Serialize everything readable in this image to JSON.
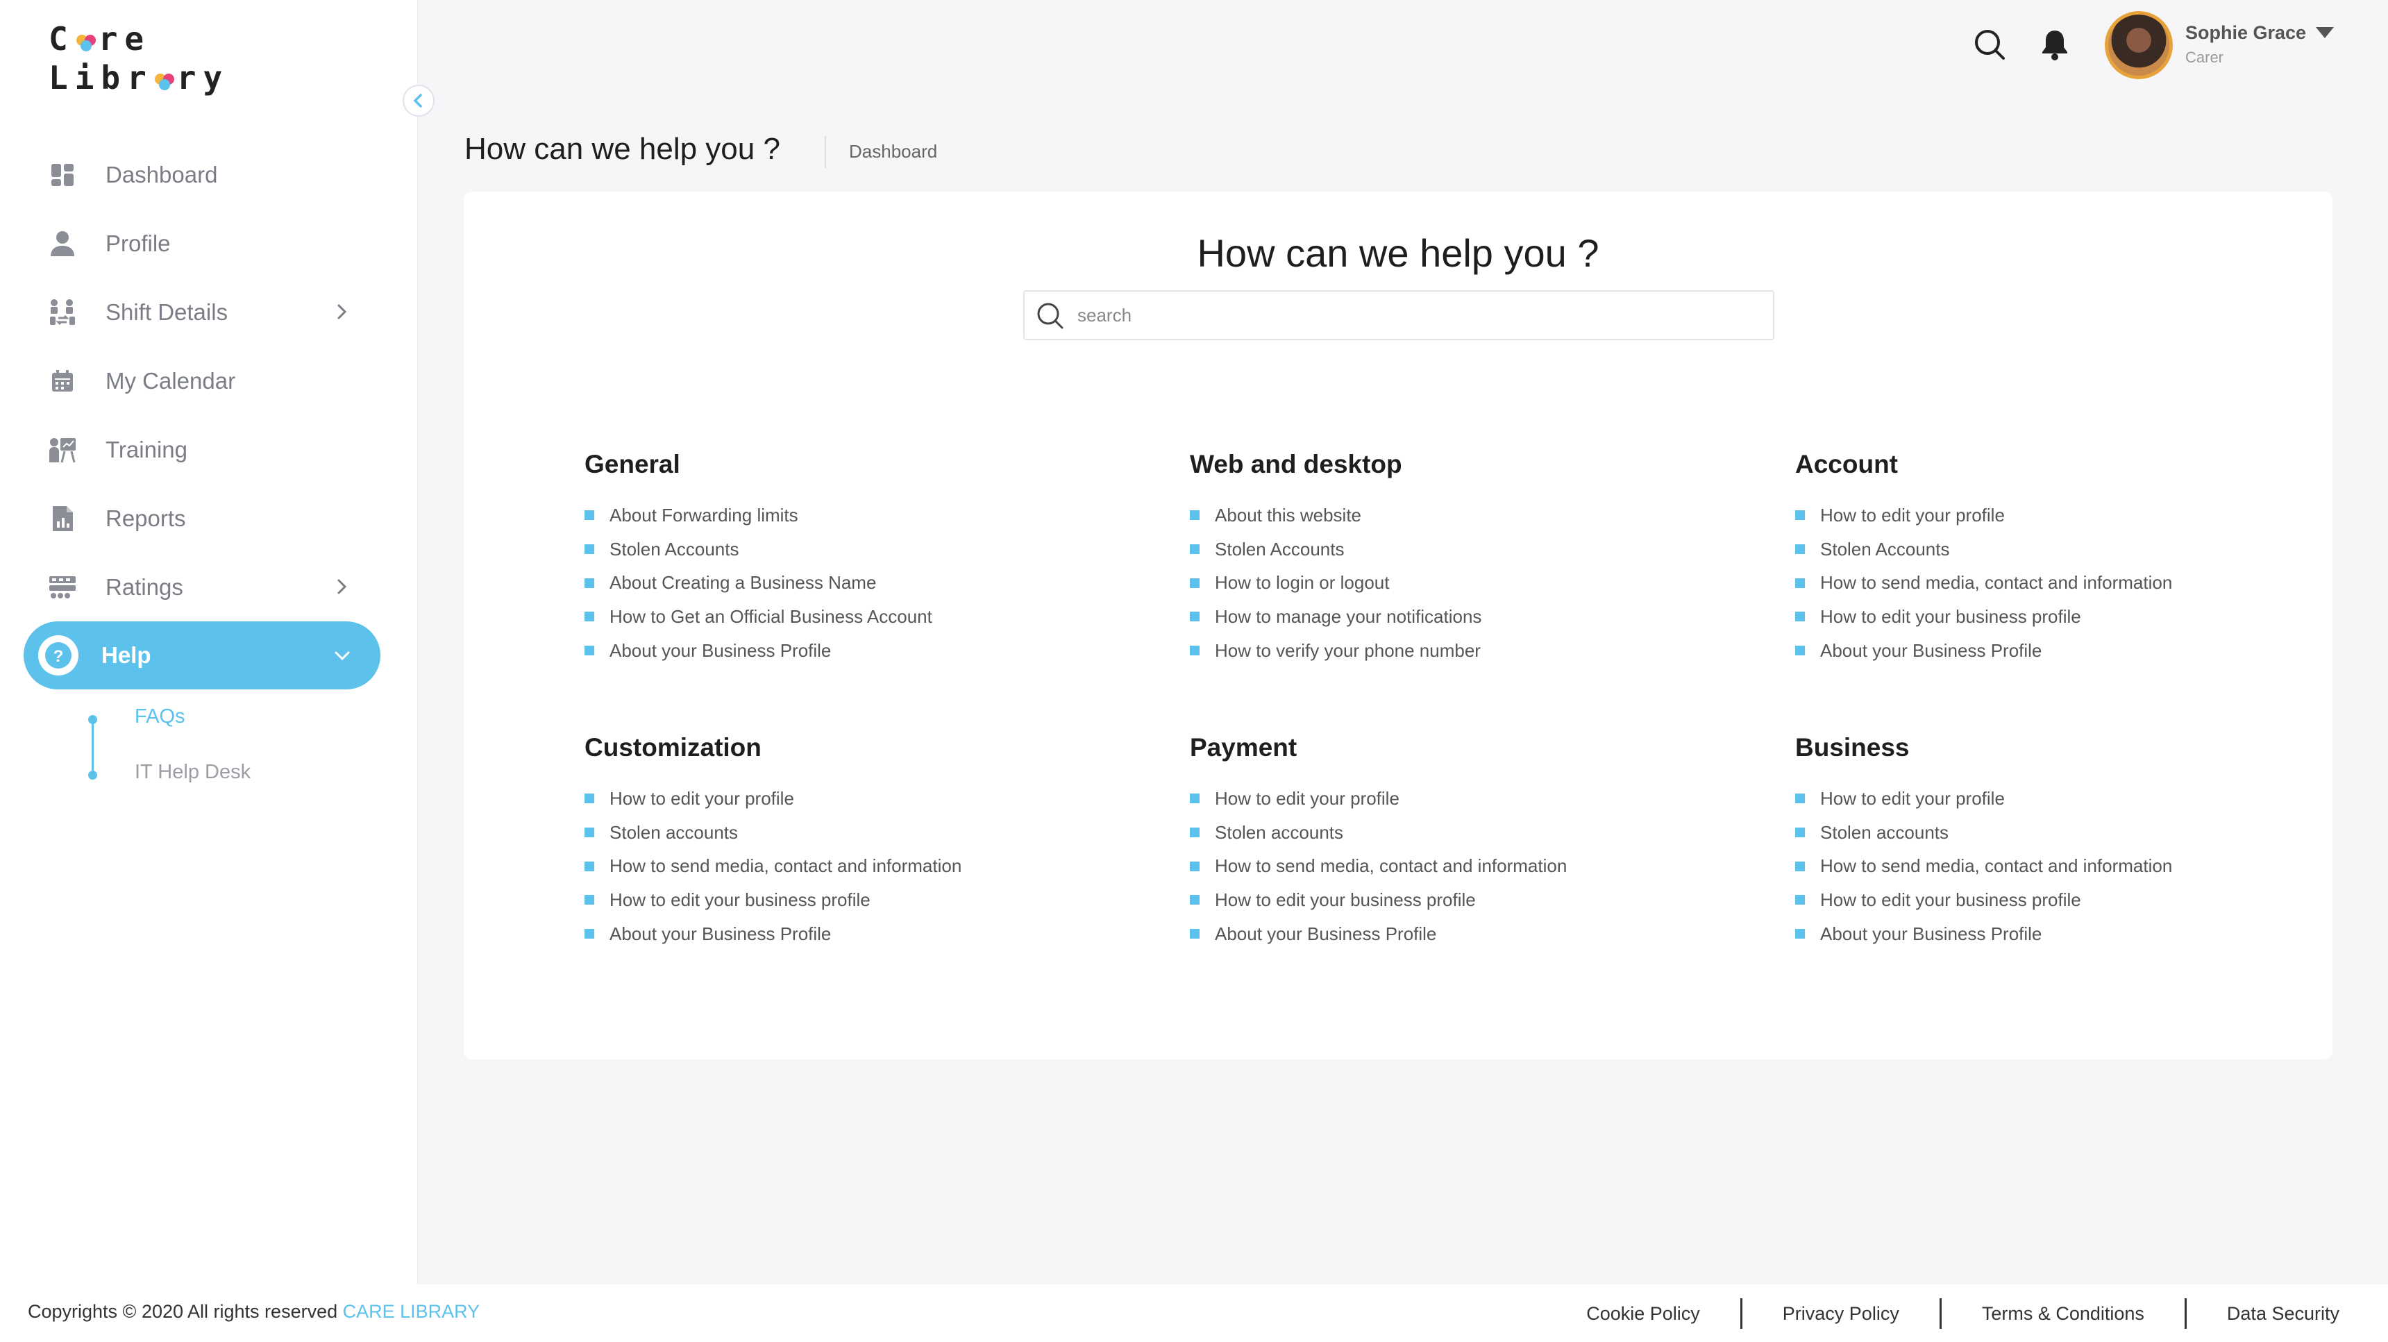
{
  "colors": {
    "accent": "#5cc2ec",
    "brand_heart": [
      "#f6b43b",
      "#e6427a",
      "#5cc2ec"
    ]
  },
  "logo": {
    "line1_a": "C",
    "line1_b": "re",
    "line2_a": "Libr",
    "line2_b": "ry"
  },
  "sidebar": {
    "items": [
      {
        "label": "Dashboard",
        "icon": "dashboard-icon"
      },
      {
        "label": "Profile",
        "icon": "user-icon"
      },
      {
        "label": "Shift Details",
        "icon": "shift-icon",
        "expandable": true
      },
      {
        "label": "My Calendar",
        "icon": "calendar-icon"
      },
      {
        "label": "Training",
        "icon": "training-icon"
      },
      {
        "label": "Reports",
        "icon": "reports-icon"
      },
      {
        "label": "Ratings",
        "icon": "ratings-icon",
        "expandable": true
      },
      {
        "label": "Help",
        "icon": "help-icon",
        "expandable": true,
        "active": true
      }
    ],
    "help_sub": [
      {
        "label": "FAQs",
        "active": true
      },
      {
        "label": "IT Help Desk",
        "active": false
      }
    ]
  },
  "header": {
    "user_name": "Sophie Grace",
    "user_role": "Carer"
  },
  "page": {
    "title": "How can we help you ?",
    "breadcrumb": "Dashboard"
  },
  "help": {
    "heading": "How can we help you ?",
    "search_placeholder": "search",
    "sections": [
      {
        "title": "General",
        "items": [
          "About Forwarding limits",
          "Stolen Accounts",
          "About Creating a Business Name",
          "How to Get an Official Business Account",
          "About your Business Profile"
        ]
      },
      {
        "title": "Web and desktop",
        "items": [
          "About  this website",
          "Stolen Accounts",
          "How to login or logout",
          "How to manage your notifications",
          "How to verify your phone number"
        ]
      },
      {
        "title": "Account",
        "items": [
          "How to edit your profile",
          "Stolen Accounts",
          "How to send media, contact and information",
          "How to edit your business profile",
          "About your Business Profile"
        ]
      },
      {
        "title": "Customization",
        "items": [
          "How to edit your profile",
          "Stolen accounts",
          "How to send media, contact and information",
          "How to edit your business profile",
          "About your Business Profile"
        ]
      },
      {
        "title": "Payment",
        "items": [
          "How to edit your profile",
          "Stolen accounts",
          "How to send media, contact and information",
          "How to edit your business profile",
          "About your Business Profile"
        ]
      },
      {
        "title": "Business",
        "items": [
          "How to edit your profile",
          "Stolen accounts",
          "How to send media, contact and information",
          "How to edit your business profile",
          "About your Business Profile"
        ]
      }
    ]
  },
  "footer": {
    "copyright": "Copyrights © 2020  All rights reserved ",
    "brand": "Care Library",
    "links": [
      "Cookie Policy",
      "Privacy Policy",
      "Terms & Conditions",
      "Data Security"
    ]
  }
}
